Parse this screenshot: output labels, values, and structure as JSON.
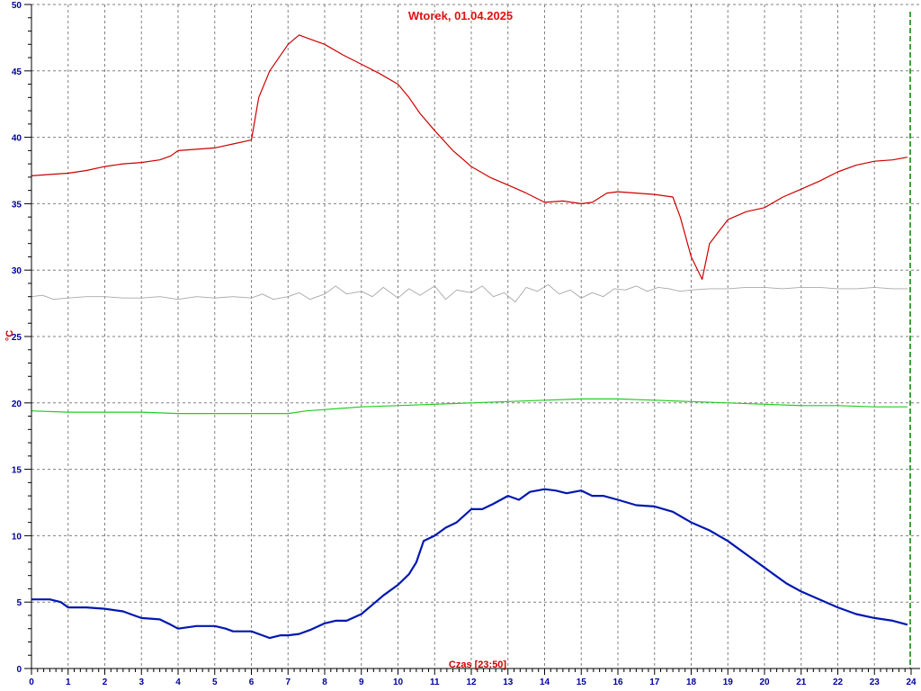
{
  "chart_data": {
    "type": "line",
    "title": "Wtorek, 01.04.2025",
    "xlabel": "Czas [23:50]",
    "ylabel": "°C",
    "xlim": [
      0,
      24
    ],
    "ylim": [
      0,
      50
    ],
    "x_ticks": [
      "0",
      "1",
      "2",
      "3",
      "4",
      "5",
      "6",
      "7",
      "8",
      "9",
      "10",
      "11",
      "12",
      "13",
      "14",
      "15",
      "16",
      "17",
      "18",
      "19",
      "20",
      "21",
      "22",
      "23",
      "24"
    ],
    "y_ticks": [
      "0",
      "5",
      "10",
      "15",
      "20",
      "25",
      "30",
      "35",
      "40",
      "45",
      "50"
    ],
    "grid": true,
    "current_time_marker": 24,
    "colors": {
      "axis_text": "#0000a0",
      "title": "#e01010",
      "ylabel": "#c00000",
      "grid": "#808080",
      "marker": "#008000"
    },
    "series": [
      {
        "color": "#cc0000",
        "width": 1.2,
        "points": [
          [
            0,
            37.1
          ],
          [
            0.5,
            37.2
          ],
          [
            1,
            37.3
          ],
          [
            1.5,
            37.5
          ],
          [
            2,
            37.8
          ],
          [
            2.5,
            38.0
          ],
          [
            3,
            38.1
          ],
          [
            3.5,
            38.3
          ],
          [
            3.8,
            38.6
          ],
          [
            4,
            39.0
          ],
          [
            4.5,
            39.1
          ],
          [
            5,
            39.2
          ],
          [
            5.5,
            39.5
          ],
          [
            6,
            39.8
          ],
          [
            6.2,
            43.0
          ],
          [
            6.5,
            45.0
          ],
          [
            7,
            47.0
          ],
          [
            7.3,
            47.7
          ],
          [
            7.6,
            47.4
          ],
          [
            8,
            47.0
          ],
          [
            8.5,
            46.2
          ],
          [
            9,
            45.5
          ],
          [
            9.5,
            44.8
          ],
          [
            10,
            44.0
          ],
          [
            10.3,
            43.0
          ],
          [
            10.6,
            41.8
          ],
          [
            11,
            40.5
          ],
          [
            11.5,
            39.0
          ],
          [
            12,
            37.8
          ],
          [
            12.5,
            37.0
          ],
          [
            13,
            36.4
          ],
          [
            13.5,
            35.8
          ],
          [
            14,
            35.1
          ],
          [
            14.5,
            35.2
          ],
          [
            15,
            35.0
          ],
          [
            15.3,
            35.1
          ],
          [
            15.7,
            35.8
          ],
          [
            16,
            35.9
          ],
          [
            16.5,
            35.8
          ],
          [
            17,
            35.7
          ],
          [
            17.5,
            35.5
          ],
          [
            17.7,
            34.0
          ],
          [
            18,
            31.0
          ],
          [
            18.3,
            29.3
          ],
          [
            18.5,
            32.0
          ],
          [
            19,
            33.8
          ],
          [
            19.5,
            34.4
          ],
          [
            20,
            34.7
          ],
          [
            20.5,
            35.5
          ],
          [
            21,
            36.1
          ],
          [
            21.5,
            36.7
          ],
          [
            22,
            37.4
          ],
          [
            22.5,
            37.9
          ],
          [
            23,
            38.2
          ],
          [
            23.5,
            38.3
          ],
          [
            23.9,
            38.5
          ]
        ]
      },
      {
        "color": "#a8a8a8",
        "width": 0.9,
        "points": [
          [
            0,
            28.0
          ],
          [
            0.3,
            28.1
          ],
          [
            0.6,
            27.8
          ],
          [
            1,
            27.9
          ],
          [
            1.5,
            28.0
          ],
          [
            2,
            28.0
          ],
          [
            2.5,
            27.9
          ],
          [
            3,
            27.9
          ],
          [
            3.5,
            28.0
          ],
          [
            4,
            27.8
          ],
          [
            4.5,
            28.0
          ],
          [
            5,
            27.9
          ],
          [
            5.5,
            28.0
          ],
          [
            6,
            27.9
          ],
          [
            6.3,
            28.2
          ],
          [
            6.6,
            27.8
          ],
          [
            7,
            28.0
          ],
          [
            7.3,
            28.3
          ],
          [
            7.6,
            27.8
          ],
          [
            8,
            28.2
          ],
          [
            8.3,
            28.8
          ],
          [
            8.6,
            28.2
          ],
          [
            9,
            28.4
          ],
          [
            9.3,
            28.0
          ],
          [
            9.6,
            28.7
          ],
          [
            10,
            27.9
          ],
          [
            10.3,
            28.6
          ],
          [
            10.6,
            28.1
          ],
          [
            11,
            28.8
          ],
          [
            11.3,
            27.8
          ],
          [
            11.6,
            28.5
          ],
          [
            12,
            28.3
          ],
          [
            12.3,
            28.8
          ],
          [
            12.6,
            28.0
          ],
          [
            12.9,
            28.3
          ],
          [
            13.2,
            27.6
          ],
          [
            13.5,
            28.7
          ],
          [
            13.8,
            28.4
          ],
          [
            14.1,
            28.9
          ],
          [
            14.4,
            28.2
          ],
          [
            14.7,
            28.5
          ],
          [
            15,
            27.9
          ],
          [
            15.3,
            28.3
          ],
          [
            15.6,
            28.0
          ],
          [
            15.9,
            28.6
          ],
          [
            16.2,
            28.5
          ],
          [
            16.5,
            28.8
          ],
          [
            16.8,
            28.4
          ],
          [
            17.1,
            28.7
          ],
          [
            17.4,
            28.6
          ],
          [
            17.7,
            28.4
          ],
          [
            18,
            28.5
          ],
          [
            18.5,
            28.6
          ],
          [
            19,
            28.6
          ],
          [
            19.5,
            28.7
          ],
          [
            20,
            28.7
          ],
          [
            20.5,
            28.6
          ],
          [
            21,
            28.7
          ],
          [
            21.5,
            28.7
          ],
          [
            22,
            28.6
          ],
          [
            22.5,
            28.6
          ],
          [
            23,
            28.7
          ],
          [
            23.5,
            28.6
          ],
          [
            23.9,
            28.6
          ]
        ]
      },
      {
        "color": "#22cc22",
        "width": 1.2,
        "points": [
          [
            0,
            19.4
          ],
          [
            1,
            19.3
          ],
          [
            2,
            19.3
          ],
          [
            3,
            19.3
          ],
          [
            4,
            19.2
          ],
          [
            5,
            19.2
          ],
          [
            6,
            19.2
          ],
          [
            7,
            19.2
          ],
          [
            7.5,
            19.4
          ],
          [
            8,
            19.5
          ],
          [
            9,
            19.7
          ],
          [
            10,
            19.8
          ],
          [
            11,
            19.9
          ],
          [
            12,
            20.0
          ],
          [
            13,
            20.1
          ],
          [
            14,
            20.2
          ],
          [
            15,
            20.3
          ],
          [
            16,
            20.3
          ],
          [
            17,
            20.2
          ],
          [
            18,
            20.1
          ],
          [
            19,
            20.0
          ],
          [
            20,
            19.9
          ],
          [
            21,
            19.8
          ],
          [
            22,
            19.8
          ],
          [
            23,
            19.7
          ],
          [
            23.9,
            19.7
          ]
        ]
      },
      {
        "color": "#0018b0",
        "width": 2.2,
        "points": [
          [
            0,
            5.2
          ],
          [
            0.5,
            5.2
          ],
          [
            0.8,
            5.0
          ],
          [
            1,
            4.6
          ],
          [
            1.5,
            4.6
          ],
          [
            2,
            4.5
          ],
          [
            2.5,
            4.3
          ],
          [
            2.8,
            4.0
          ],
          [
            3,
            3.8
          ],
          [
            3.5,
            3.7
          ],
          [
            3.8,
            3.3
          ],
          [
            4,
            3.0
          ],
          [
            4.5,
            3.2
          ],
          [
            5,
            3.2
          ],
          [
            5.3,
            3.0
          ],
          [
            5.5,
            2.8
          ],
          [
            6,
            2.8
          ],
          [
            6.3,
            2.5
          ],
          [
            6.5,
            2.3
          ],
          [
            6.8,
            2.5
          ],
          [
            7,
            2.5
          ],
          [
            7.3,
            2.6
          ],
          [
            7.6,
            2.9
          ],
          [
            8,
            3.4
          ],
          [
            8.3,
            3.6
          ],
          [
            8.6,
            3.6
          ],
          [
            9,
            4.1
          ],
          [
            9.3,
            4.8
          ],
          [
            9.6,
            5.5
          ],
          [
            10,
            6.3
          ],
          [
            10.3,
            7.1
          ],
          [
            10.5,
            8.0
          ],
          [
            10.7,
            9.6
          ],
          [
            11,
            10.0
          ],
          [
            11.3,
            10.6
          ],
          [
            11.6,
            11.0
          ],
          [
            12,
            12.0
          ],
          [
            12.3,
            12.0
          ],
          [
            12.6,
            12.4
          ],
          [
            13,
            13.0
          ],
          [
            13.3,
            12.7
          ],
          [
            13.6,
            13.3
          ],
          [
            14,
            13.5
          ],
          [
            14.3,
            13.4
          ],
          [
            14.6,
            13.2
          ],
          [
            15,
            13.4
          ],
          [
            15.3,
            13.0
          ],
          [
            15.6,
            13.0
          ],
          [
            16,
            12.7
          ],
          [
            16.5,
            12.3
          ],
          [
            17,
            12.2
          ],
          [
            17.5,
            11.8
          ],
          [
            18,
            11.0
          ],
          [
            18.5,
            10.4
          ],
          [
            19,
            9.6
          ],
          [
            19.3,
            9.0
          ],
          [
            19.6,
            8.4
          ],
          [
            20,
            7.6
          ],
          [
            20.3,
            7.0
          ],
          [
            20.6,
            6.4
          ],
          [
            21,
            5.8
          ],
          [
            21.5,
            5.2
          ],
          [
            22,
            4.6
          ],
          [
            22.5,
            4.1
          ],
          [
            23,
            3.8
          ],
          [
            23.5,
            3.6
          ],
          [
            23.9,
            3.3
          ]
        ]
      }
    ]
  }
}
